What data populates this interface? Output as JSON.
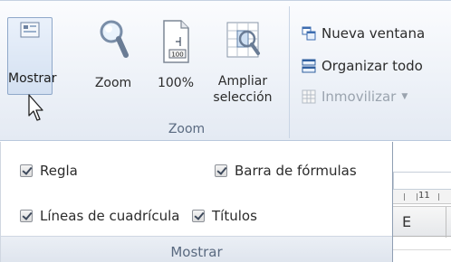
{
  "ribbon": {
    "mostrar_button": {
      "label": "Mostrar",
      "icon": "show-icon"
    },
    "zoom_group": {
      "label": "Zoom",
      "buttons": [
        {
          "label": "Zoom",
          "icon": "magnifier-icon"
        },
        {
          "label": "100%",
          "icon": "page-100-icon",
          "icon_text": "100"
        },
        {
          "label_line1": "Ampliar",
          "label_line2": "selección",
          "icon": "zoom-selection-icon"
        }
      ]
    },
    "window_group": {
      "nueva_ventana": "Nueva ventana",
      "organizar_todo": "Organizar todo",
      "inmovilizar": "Inmovilizar"
    }
  },
  "panel": {
    "title": "Mostrar",
    "checkboxes": [
      {
        "label": "Regla",
        "checked": true
      },
      {
        "label": "Barra de fórmulas",
        "checked": true
      },
      {
        "label": "Líneas de cuadrícula",
        "checked": true
      },
      {
        "label": "Títulos",
        "checked": true
      }
    ]
  },
  "sheet": {
    "ruler_number": "11",
    "column_header": "E"
  },
  "colors": {
    "ribbon_top": "#fbfcfe",
    "ribbon_bottom": "#e4eaf3",
    "active_button_border": "#8fa8c9",
    "group_label": "#5a6a80",
    "disabled_text": "#9aa3ae"
  }
}
